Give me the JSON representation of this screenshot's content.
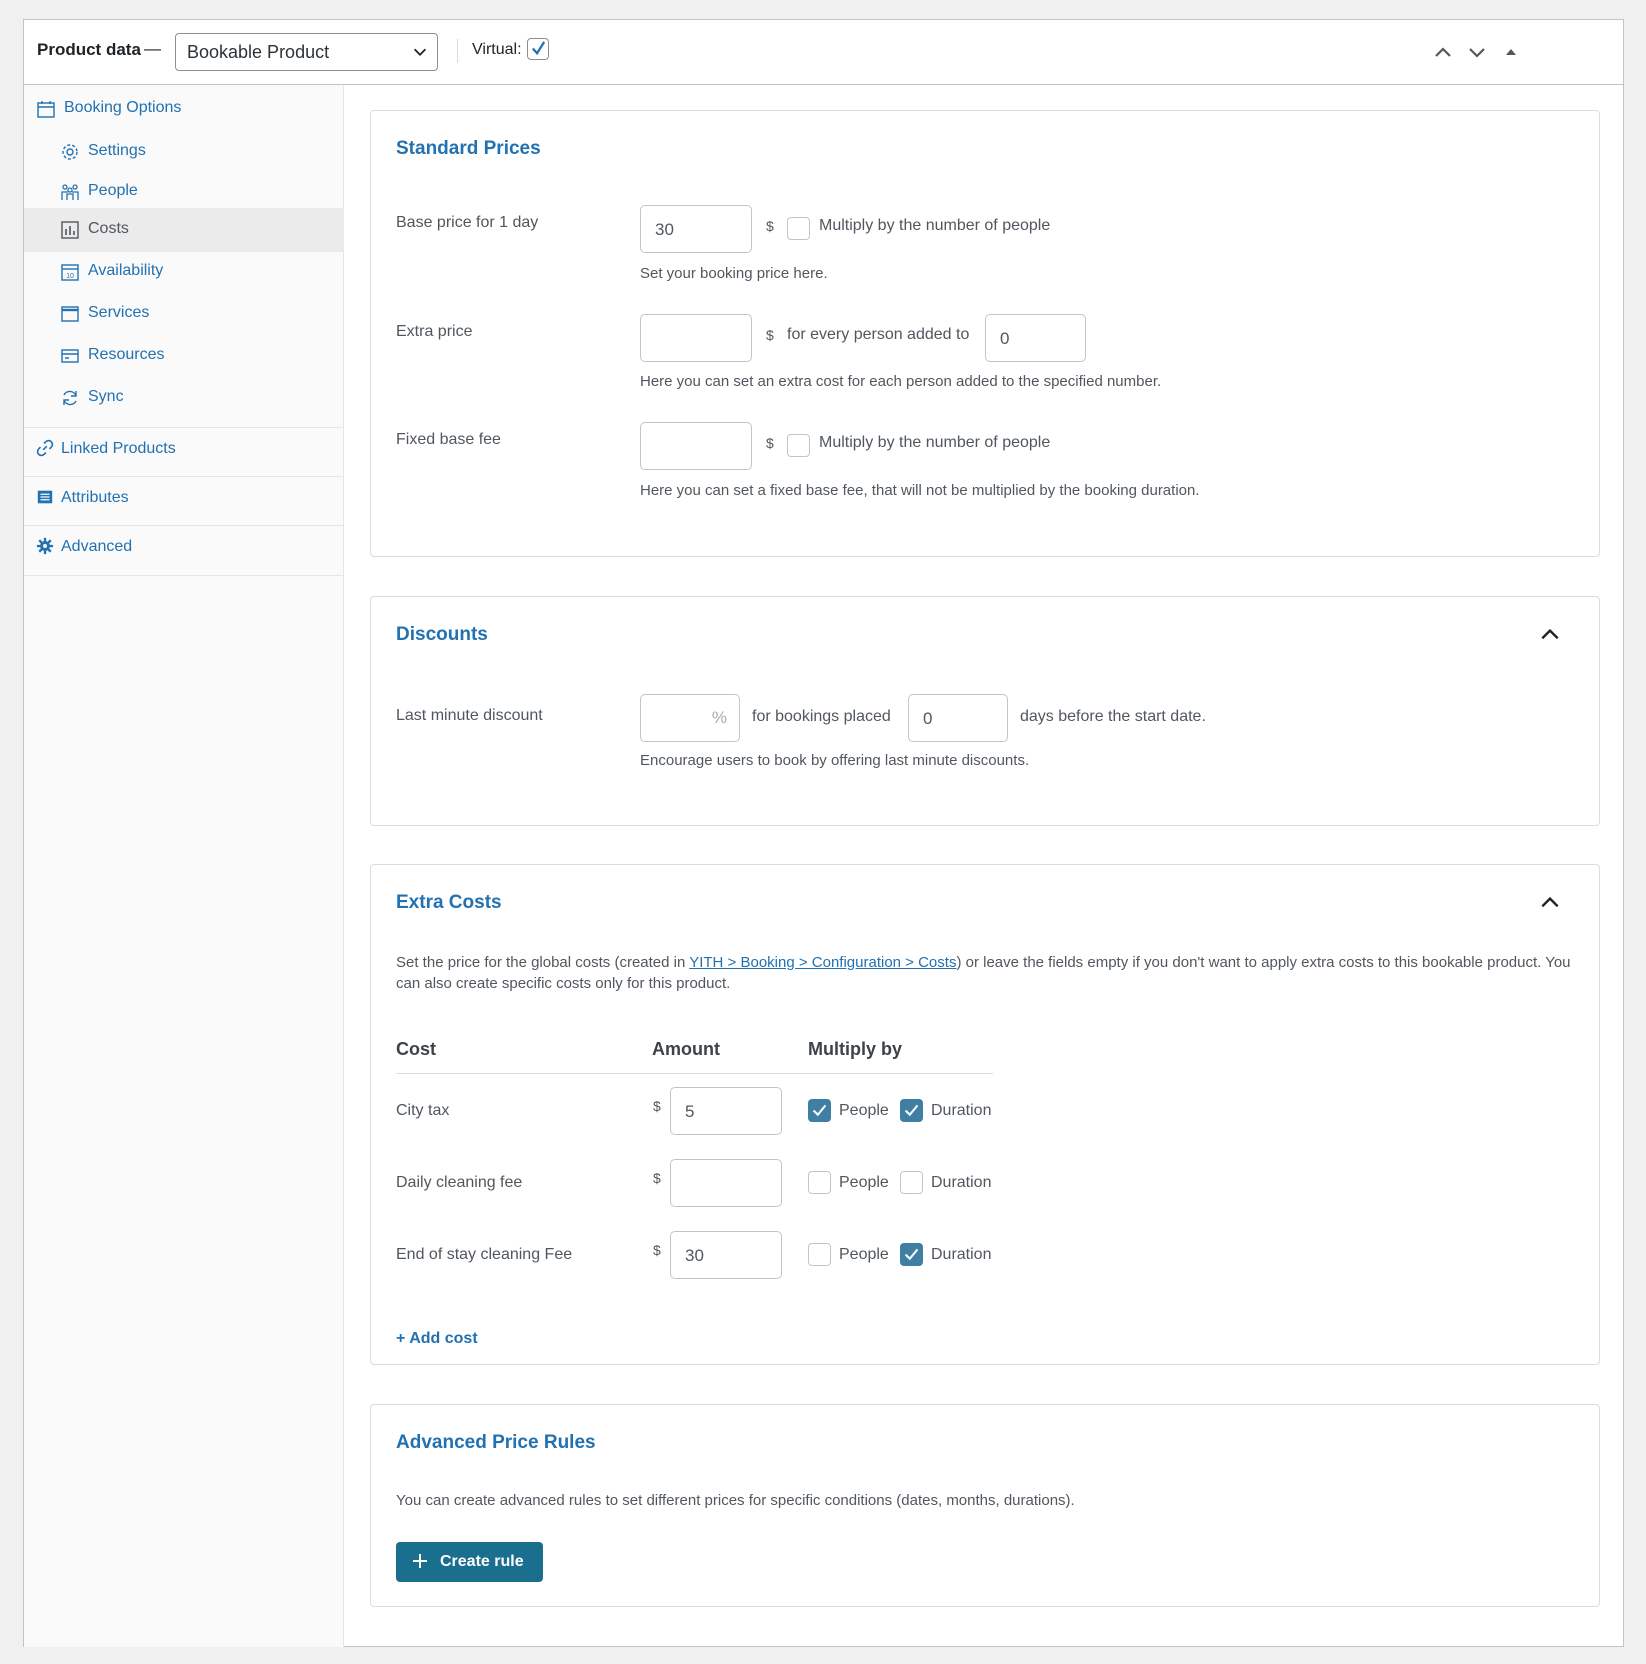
{
  "header": {
    "title": "Product data",
    "dash": "—",
    "product_type": "Bookable Product",
    "virtual_label": "Virtual:",
    "virtual_checked": true
  },
  "sidebar": {
    "items": [
      {
        "label": "Booking Options",
        "icon": "calendar-icon"
      },
      {
        "label": "Settings",
        "icon": "gear-icon"
      },
      {
        "label": "People",
        "icon": "people-icon"
      },
      {
        "label": "Costs",
        "icon": "chart-icon",
        "active": true
      },
      {
        "label": "Availability",
        "icon": "calendar-day-icon"
      },
      {
        "label": "Services",
        "icon": "window-icon"
      },
      {
        "label": "Resources",
        "icon": "card-icon"
      },
      {
        "label": "Sync",
        "icon": "sync-icon"
      },
      {
        "label": "Linked Products",
        "icon": "link-icon"
      },
      {
        "label": "Attributes",
        "icon": "list-icon"
      },
      {
        "label": "Advanced",
        "icon": "cog-icon"
      }
    ]
  },
  "standard_prices": {
    "title": "Standard Prices",
    "base_price_label": "Base price for 1 day",
    "base_price_value": "30",
    "currency": "$",
    "multiply_label": "Multiply by the number of people",
    "base_help": "Set your booking price here.",
    "extra_price_label": "Extra price",
    "extra_price_value": "",
    "every_person_label": "for every person added to",
    "every_person_value": "0",
    "extra_help": "Here you can set an extra cost for each person added to the specified number.",
    "fixed_fee_label": "Fixed base fee",
    "fixed_fee_value": "",
    "fixed_help": "Here you can set a fixed base fee, that will not be multiplied by the booking duration."
  },
  "discounts": {
    "title": "Discounts",
    "last_minute_label": "Last minute discount",
    "percent_sign": "%",
    "placed_label": "for bookings placed",
    "days_value": "0",
    "days_label": "days before the start date.",
    "help": "Encourage users to book by offering last minute discounts."
  },
  "extra_costs": {
    "title": "Extra Costs",
    "desc_before": "Set the price for the global costs (created in ",
    "desc_link": "YITH > Booking > Configuration > Costs",
    "desc_after": ") or leave the fields empty if you don't want to apply extra costs to this bookable product. You can also create specific costs only for this product.",
    "columns": {
      "cost": "Cost",
      "amount": "Amount",
      "multiply": "Multiply by"
    },
    "currency": "$",
    "people_label": "People",
    "duration_label": "Duration",
    "rows": [
      {
        "name": "City tax",
        "amount": "5",
        "people": true,
        "duration": true
      },
      {
        "name": "Daily cleaning fee",
        "amount": "",
        "people": false,
        "duration": false
      },
      {
        "name": "End of stay cleaning Fee",
        "amount": "30",
        "people": false,
        "duration": true
      }
    ],
    "add_cost": "+ Add cost"
  },
  "advanced_rules": {
    "title": "Advanced Price Rules",
    "desc": "You can create advanced rules to set different prices for specific conditions (dates, months, durations).",
    "button": "Create rule"
  },
  "colors": {
    "accent": "#2271b1",
    "primary_button": "#1a6e8e",
    "checkbox_on": "#3f7fa3"
  }
}
